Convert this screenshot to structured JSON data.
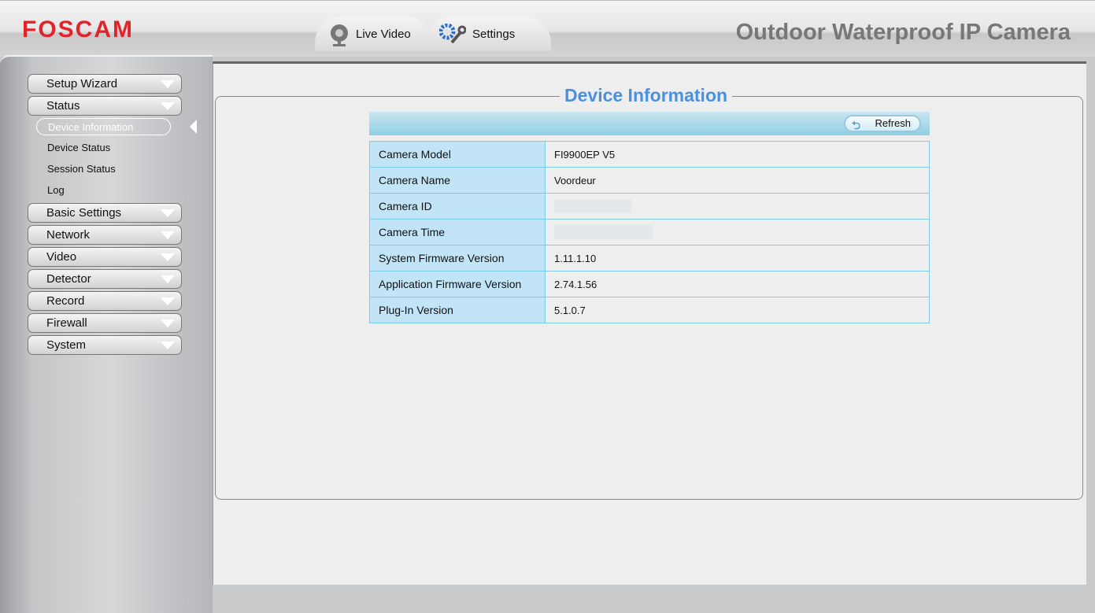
{
  "header": {
    "logo": "FOSCAM",
    "product": "Outdoor Waterproof IP Camera",
    "tabs": [
      {
        "label": "Live Video"
      },
      {
        "label": "Settings"
      }
    ]
  },
  "sidebar": {
    "menus": [
      {
        "label": "Setup Wizard"
      },
      {
        "label": "Status"
      },
      {
        "label": "Basic Settings"
      },
      {
        "label": "Network"
      },
      {
        "label": "Video"
      },
      {
        "label": "Detector"
      },
      {
        "label": "Record"
      },
      {
        "label": "Firewall"
      },
      {
        "label": "System"
      }
    ],
    "status_items": [
      {
        "label": "Device Information"
      },
      {
        "label": "Device Status"
      },
      {
        "label": "Session Status"
      },
      {
        "label": "Log"
      }
    ]
  },
  "main": {
    "title": "Device Information",
    "refresh_label": "Refresh",
    "rows": [
      {
        "label": "Camera Model",
        "value": "FI9900EP V5"
      },
      {
        "label": "Camera Name",
        "value": "Voordeur"
      },
      {
        "label": "Camera ID",
        "value": ""
      },
      {
        "label": "Camera Time",
        "value": ""
      },
      {
        "label": "System Firmware Version",
        "value": "1.11.1.10"
      },
      {
        "label": "Application Firmware Version",
        "value": "2.74.1.56"
      },
      {
        "label": "Plug-In Version",
        "value": "5.1.0.7"
      }
    ]
  }
}
